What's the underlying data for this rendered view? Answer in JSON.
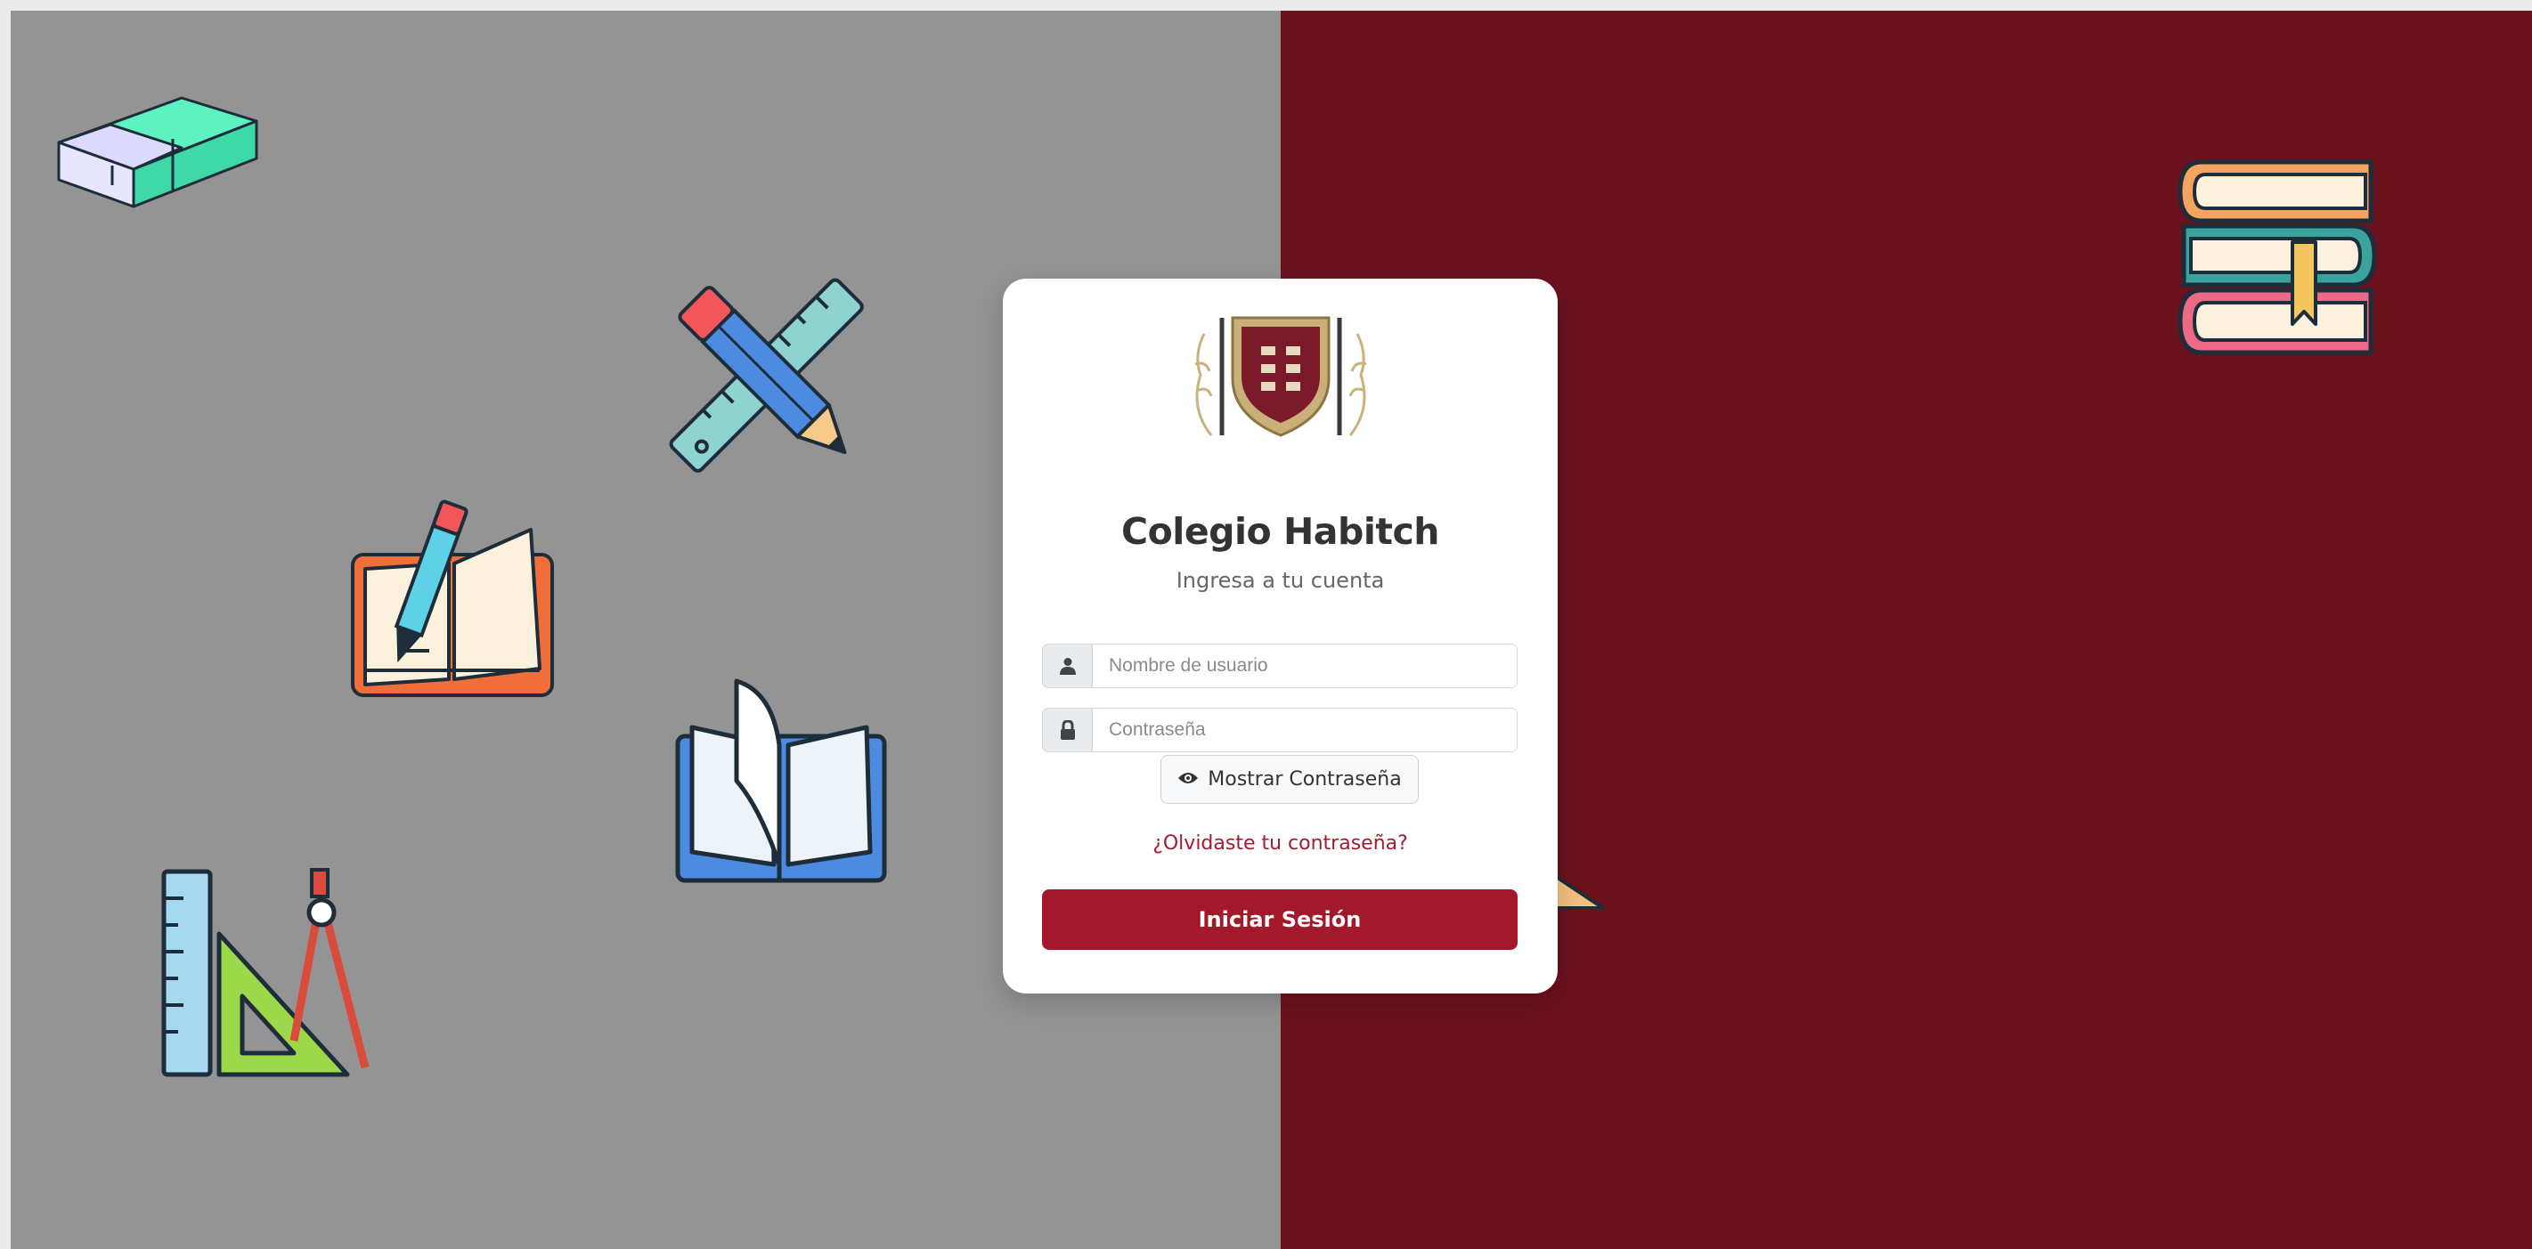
{
  "brand": {
    "title": "Colegio Habitch",
    "subtitle": "Ingresa a tu cuenta",
    "colors": {
      "left_panel": "#949494",
      "right_panel": "#6c121f",
      "accent": "#a3192b"
    }
  },
  "form": {
    "username": {
      "placeholder": "Nombre de usuario",
      "icon": "user-icon"
    },
    "password": {
      "placeholder": "Contraseña",
      "icon": "lock-icon"
    },
    "show_password_label": "Mostrar Contraseña",
    "forgot_label": "¿Olvidaste tu contraseña?",
    "submit_label": "Iniciar Sesión"
  },
  "decorations": [
    "eraser-icon",
    "ruler-pencil-icon",
    "notebook-pen-icon",
    "open-book-icon",
    "geometry-set-icon",
    "stacked-books-icon"
  ]
}
